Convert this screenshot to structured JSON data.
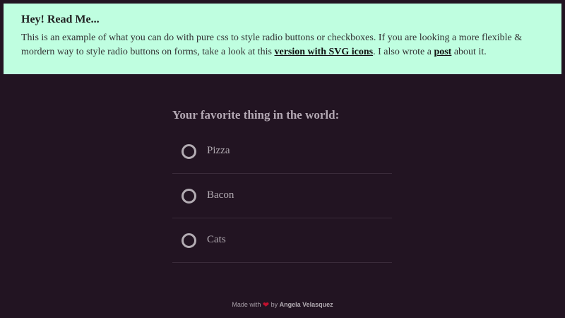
{
  "notice": {
    "title": "Hey! Read Me...",
    "text_1": "This is an example of what you can do with pure css to style radio buttons or checkboxes. If you are looking a more flexible & mordern way to style radio buttons on forms, take a look at this ",
    "link_1": "version with SVG icons",
    "text_2": ". I also wrote a ",
    "link_2": "post",
    "text_3": " about it.",
    "background_color": "#bffee0"
  },
  "form": {
    "title": "Your favorite thing in the world:",
    "options": [
      {
        "label": "Pizza",
        "checked": false
      },
      {
        "label": "Bacon",
        "checked": false
      },
      {
        "label": "Cats",
        "checked": false
      }
    ]
  },
  "footer": {
    "made_with": "Made with",
    "heart_icon": "heart-icon",
    "heart_glyph": "❤",
    "heart_color": "#c4102e",
    "by": "by",
    "author": "Angela Velasquez"
  },
  "colors": {
    "background": "#221422",
    "option_text": "#b3acb3"
  }
}
